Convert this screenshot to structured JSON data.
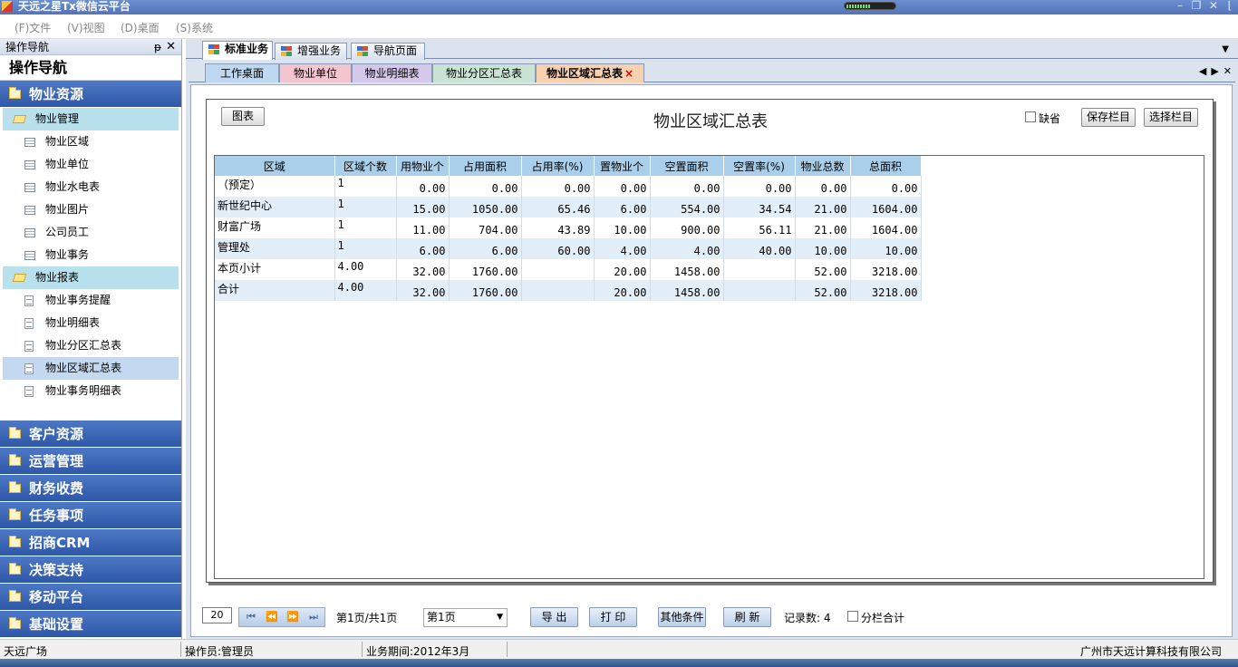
{
  "window": {
    "title": "天远之星Tx微信云平台",
    "progress": 0.5
  },
  "menu": [
    {
      "label": "(F)文件"
    },
    {
      "label": "(V)视图"
    },
    {
      "label": "(D)桌面"
    },
    {
      "label": "(S)系统"
    }
  ],
  "nav": {
    "header": "操作导航",
    "title": "操作导航",
    "groups_top": [
      "物业资源"
    ],
    "tree": [
      {
        "type": "subhead",
        "label": "物业管理"
      },
      {
        "type": "leaf",
        "icon": "grid",
        "label": "物业区域"
      },
      {
        "type": "leaf",
        "icon": "grid",
        "label": "物业单位"
      },
      {
        "type": "leaf",
        "icon": "grid",
        "label": "物业水电表"
      },
      {
        "type": "leaf",
        "icon": "grid",
        "label": "物业图片"
      },
      {
        "type": "leaf",
        "icon": "grid",
        "label": "公司员工"
      },
      {
        "type": "leaf",
        "icon": "grid",
        "label": "物业事务"
      },
      {
        "type": "subhead",
        "label": "物业报表"
      },
      {
        "type": "leaf",
        "icon": "doc",
        "label": "物业事务提醒"
      },
      {
        "type": "leaf",
        "icon": "doc",
        "label": "物业明细表"
      },
      {
        "type": "leaf",
        "icon": "doc",
        "label": "物业分区汇总表"
      },
      {
        "type": "leaf",
        "icon": "doc",
        "label": "物业区域汇总表",
        "active": true
      },
      {
        "type": "leaf",
        "icon": "doc",
        "label": "物业事务明细表"
      }
    ],
    "groups_bottom": [
      "客户资源",
      "运营管理",
      "财务收费",
      "任务事项",
      "招商CRM",
      "决策支持",
      "移动平台",
      "基础设置"
    ]
  },
  "tabs_primary": [
    {
      "label": "标准业务",
      "active": true
    },
    {
      "label": "增强业务"
    },
    {
      "label": "导航页面"
    }
  ],
  "tabs_secondary": [
    {
      "label": "工作桌面",
      "color": "#bfd8f1"
    },
    {
      "label": "物业单位",
      "color": "#f3c6cf"
    },
    {
      "label": "物业明细表",
      "color": "#d5c9ea"
    },
    {
      "label": "物业分区汇总表",
      "color": "#c9e4d3"
    },
    {
      "label": "物业区域汇总表",
      "color": "#f8d2b0",
      "active": true,
      "close": "×"
    }
  ],
  "report": {
    "title": "物业区域汇总表",
    "chart_button": "图表",
    "default_checkbox": "缺省",
    "save_columns": "保存栏目",
    "select_columns": "选择栏目",
    "columns": [
      "区域",
      "区域个数",
      "用物业个",
      "占用面积",
      "占用率(%)",
      "置物业个",
      "空置面积",
      "空置率(%)",
      "物业总数",
      "总面积"
    ],
    "rows": [
      [
        "（预定）",
        "1",
        "0.00",
        "0.00",
        "0.00",
        "0.00",
        "0.00",
        "0.00",
        "0.00",
        "0.00"
      ],
      [
        "新世纪中心",
        "1",
        "15.00",
        "1050.00",
        "65.46",
        "6.00",
        "554.00",
        "34.54",
        "21.00",
        "1604.00"
      ],
      [
        "财富广场",
        "1",
        "11.00",
        "704.00",
        "43.89",
        "10.00",
        "900.00",
        "56.11",
        "21.00",
        "1604.00"
      ],
      [
        "管理处",
        "1",
        "6.00",
        "6.00",
        "60.00",
        "4.00",
        "4.00",
        "40.00",
        "10.00",
        "10.00"
      ],
      [
        "本页小计",
        "4.00",
        "32.00",
        "1760.00",
        "",
        "20.00",
        "1458.00",
        "",
        "52.00",
        "3218.00"
      ],
      [
        "合计",
        "4.00",
        "32.00",
        "1760.00",
        "",
        "20.00",
        "1458.00",
        "",
        "52.00",
        "3218.00"
      ]
    ]
  },
  "pager": {
    "page_size": "20",
    "page_info": "第1页/共1页",
    "page_select": "第1页",
    "export": "导 出",
    "print": "打 印",
    "other_conditions": "其他条件",
    "refresh": "刷 新",
    "records": "记录数: 4",
    "column_total": "分栏合计"
  },
  "status": {
    "location": "天远广场",
    "operator": "操作员:管理员",
    "period": "业务期间:2012年3月",
    "company": "广州市天远计算科技有限公司"
  }
}
